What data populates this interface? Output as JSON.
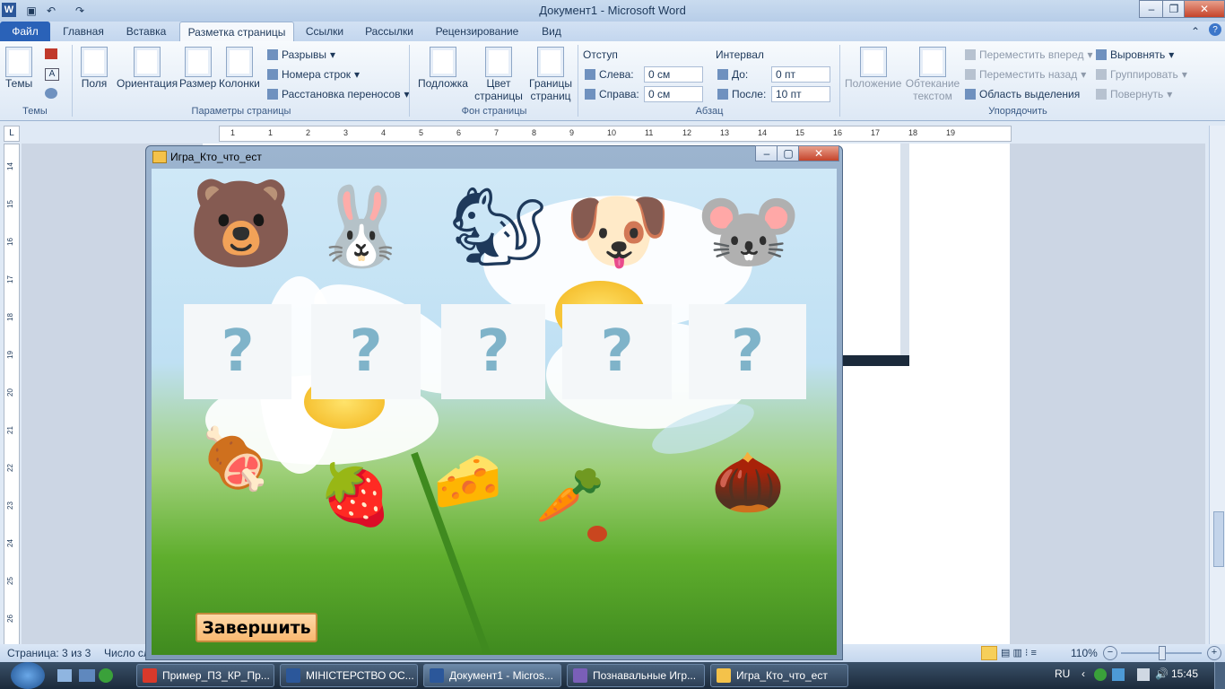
{
  "window": {
    "title": "Документ1 - Microsoft Word"
  },
  "tabs": [
    {
      "label": "Файл"
    },
    {
      "label": "Главная"
    },
    {
      "label": "Вставка"
    },
    {
      "label": "Разметка страницы"
    },
    {
      "label": "Ссылки"
    },
    {
      "label": "Рассылки"
    },
    {
      "label": "Рецензирование"
    },
    {
      "label": "Вид"
    }
  ],
  "ribbon": {
    "themes": {
      "btn": "Темы",
      "group": "Темы"
    },
    "page_setup": {
      "fields": "Поля",
      "orientation": "Ориентация",
      "size": "Размер",
      "columns": "Колонки",
      "breaks": "Разрывы",
      "line_numbers": "Номера строк",
      "hyphenation": "Расстановка переносов",
      "group": "Параметры страницы"
    },
    "background": {
      "watermark": "Подложка",
      "page_color": "Цвет страницы",
      "page_borders": "Границы страниц",
      "group": "Фон страницы"
    },
    "paragraph": {
      "indent": "Отступ",
      "left_label": "Слева:",
      "left_val": "0 см",
      "right_label": "Справа:",
      "right_val": "0 см",
      "spacing": "Интервал",
      "before_label": "До:",
      "before_val": "0 пт",
      "after_label": "После:",
      "after_val": "10 пт",
      "group": "Абзац"
    },
    "arrange": {
      "position": "Положение",
      "wrap": "Обтекание текстом",
      "bring_forward": "Переместить вперед",
      "send_backward": "Переместить назад",
      "selection_pane": "Область выделения",
      "align": "Выровнять",
      "group_btn": "Группировать",
      "rotate": "Повернуть",
      "group": "Упорядочить"
    }
  },
  "ruler": {
    "ticks": [
      "1",
      "1",
      "2",
      "3",
      "4",
      "5",
      "6",
      "7",
      "8",
      "9",
      "10",
      "11",
      "12",
      "13",
      "14",
      "15",
      "16",
      "17",
      "18",
      "19"
    ]
  },
  "vruler": {
    "ticks": [
      "14",
      "15",
      "16",
      "17",
      "18",
      "19",
      "20",
      "21",
      "22",
      "23",
      "24",
      "25",
      "26"
    ]
  },
  "status": {
    "page": "Страница: 3 из 3",
    "words": "Число сл",
    "zoom": "110%"
  },
  "game": {
    "title": "Игра_Кто_что_ест",
    "animals": [
      {
        "name": "bear",
        "glyph": "🐻"
      },
      {
        "name": "rabbit",
        "glyph": "🐰"
      },
      {
        "name": "squirrel",
        "glyph": "🐿"
      },
      {
        "name": "puppy",
        "glyph": "🐶"
      },
      {
        "name": "mouse",
        "glyph": "🐭"
      }
    ],
    "question_mark": "?",
    "foods": [
      {
        "name": "ham",
        "glyph": "🍖"
      },
      {
        "name": "raspberry",
        "glyph": "🍓"
      },
      {
        "name": "cheese",
        "glyph": "🧀"
      },
      {
        "name": "carrot",
        "glyph": "🥕"
      },
      {
        "name": "hazelnut",
        "glyph": "🌰"
      }
    ],
    "finish_button": "Завершить"
  },
  "taskbar": {
    "items": [
      "Пример_ПЗ_КР_Пр...",
      "МІНІСТЕРСТВО ОС...",
      "Документ1 - Micros...",
      "Познавальные Игр...",
      "Игра_Кто_что_ест"
    ],
    "lang": "RU",
    "time": "15:45"
  },
  "colors": {
    "accent": "#2a62b8",
    "button": "#f9b870"
  }
}
